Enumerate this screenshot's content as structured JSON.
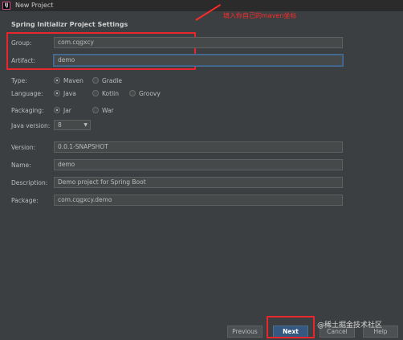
{
  "window": {
    "title": "New Project",
    "icon_label": "IJ"
  },
  "section_title": "Spring Initializr Project Settings",
  "annotation_text": "填入你自己的maven坐标",
  "fields": {
    "group": {
      "label": "Group:",
      "value": "com.cqgxcy"
    },
    "artifact": {
      "label": "Artifact:",
      "value": "demo"
    },
    "version": {
      "label": "Version:",
      "value": "0.0.1-SNAPSHOT"
    },
    "name": {
      "label": "Name:",
      "value": "demo"
    },
    "description": {
      "label": "Description:",
      "value": "Demo project for Spring Boot"
    },
    "package": {
      "label": "Package:",
      "value": "com.cqgxcy.demo"
    }
  },
  "type": {
    "label": "Type:",
    "options": [
      "Maven",
      "Gradle"
    ],
    "selected": "Maven"
  },
  "language": {
    "label": "Language:",
    "options": [
      "Java",
      "Kotlin",
      "Groovy"
    ],
    "selected": "Java"
  },
  "packaging": {
    "label": "Packaging:",
    "options": [
      "Jar",
      "War"
    ],
    "selected": "Jar"
  },
  "java_version": {
    "label": "Java version:",
    "value": "8",
    "arrow_icon": "chevron-down-icon"
  },
  "buttons": {
    "previous": "Previous",
    "next": "Next",
    "cancel": "Cancel",
    "help": "Help"
  },
  "watermark": "@稀土掘金技术社区",
  "colors": {
    "background": "#3c3f41",
    "annotation": "#e8262b",
    "primary_button": "#365880"
  }
}
